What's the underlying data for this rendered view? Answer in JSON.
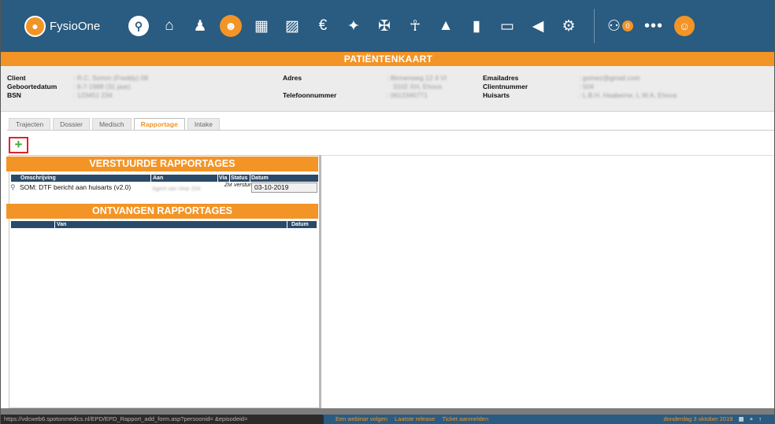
{
  "app": {
    "name": "FysioOne"
  },
  "nav": {
    "icons": [
      "search-icon",
      "home-icon",
      "person-icon",
      "group-icon",
      "calendar-icon",
      "folder-icon",
      "euro-icon",
      "handshake-icon",
      "running-icon",
      "figure-icon",
      "hierarchy-icon",
      "bar-chart-icon",
      "book-icon",
      "reply-icon",
      "settings-icon"
    ],
    "support_badge": "0"
  },
  "page": {
    "title": "PATIËNTENKAART"
  },
  "patient": {
    "labels": {
      "client": "Client",
      "birthdate": "Geboortedatum",
      "bsn": "BSN",
      "address": "Adres",
      "phone": "Telefoonnummer",
      "email": "Emailadres",
      "client_number": "Clientnummer",
      "gp": "Huisarts"
    },
    "values": {
      "client": ": R.C. Somm (Freddy) 08",
      "birthdate": ": 8-7-1988 (31 jaar)",
      "bsn": ": 123451 234",
      "address": ": Binnenweg 12 4 VI",
      "address2": "3102 XH, Ehova",
      "phone": ": 0612345771",
      "email": ": gomez@gmail.com",
      "client_number": ": 504",
      "gp": ": L.B.H. Haaberne, L.W.A, Ehova"
    }
  },
  "tabs": [
    "Trajecten",
    "Dossier",
    "Medisch",
    "Rapportage",
    "Intake"
  ],
  "active_tab": "Rapportage",
  "add_button": {
    "label": "+"
  },
  "sent": {
    "heading": "VERSTUURDE RAPPORTAGES",
    "columns": {
      "description": "Omschrijving",
      "to": "Aan",
      "via": "Via",
      "status": "Status",
      "date": "Datum"
    },
    "rows": [
      {
        "description": "SOM: DTF bericht aan huisarts (v2.0)",
        "to": "Agent van Vear 204",
        "via": "ZM",
        "status": "versturen",
        "date": "03-10-2019"
      }
    ]
  },
  "received": {
    "heading": "ONTVANGEN RAPPORTAGES",
    "columns": {
      "from": "Van",
      "date": "Datum"
    }
  },
  "status_bar": {
    "url": "https://vdcweb6.spotonmedics.nl/EPD/EPD_Rapport_add_form.asp?persoonid=         &episodeid=",
    "links": [
      "Een webinar volgen",
      "Laatste release",
      "Ticket aanmelden"
    ],
    "date": "donderdag 3 oktober 2019"
  },
  "colors": {
    "navy": "#2a5b80",
    "orange": "#f39426"
  }
}
